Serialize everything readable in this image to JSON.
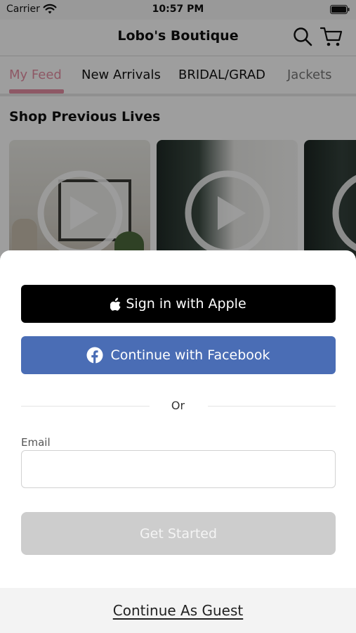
{
  "status_bar": {
    "carrier": "Carrier",
    "time": "10:57 PM",
    "icons": [
      "wifi-icon",
      "battery-icon"
    ]
  },
  "header": {
    "title": "Lobo's Boutique",
    "icons": [
      "search-icon",
      "cart-icon"
    ]
  },
  "tabs": {
    "items": [
      {
        "label": "My Feed",
        "active": true
      },
      {
        "label": "New Arrivals",
        "active": false
      },
      {
        "label": "BRIDAL/GRAD",
        "active": false
      },
      {
        "label": "Jackets",
        "active": false
      }
    ],
    "accent_color": "#e58ea3"
  },
  "section": {
    "title": "Shop Previous Lives",
    "thumbnails": [
      {
        "icon": "play-icon"
      },
      {
        "icon": "play-icon"
      },
      {
        "icon": "play-icon"
      }
    ]
  },
  "sheet": {
    "apple_button": {
      "label": "Sign in with Apple",
      "icon": "apple-icon",
      "color": "#000000"
    },
    "facebook_button": {
      "label": "Continue with Facebook",
      "icon": "facebook-icon",
      "color": "#4a6db5"
    },
    "divider_text": "Or",
    "email": {
      "label": "Email",
      "value": "",
      "placeholder": ""
    },
    "get_started_button": {
      "label": "Get Started",
      "enabled": false
    },
    "guest_link": "Continue As Guest"
  }
}
